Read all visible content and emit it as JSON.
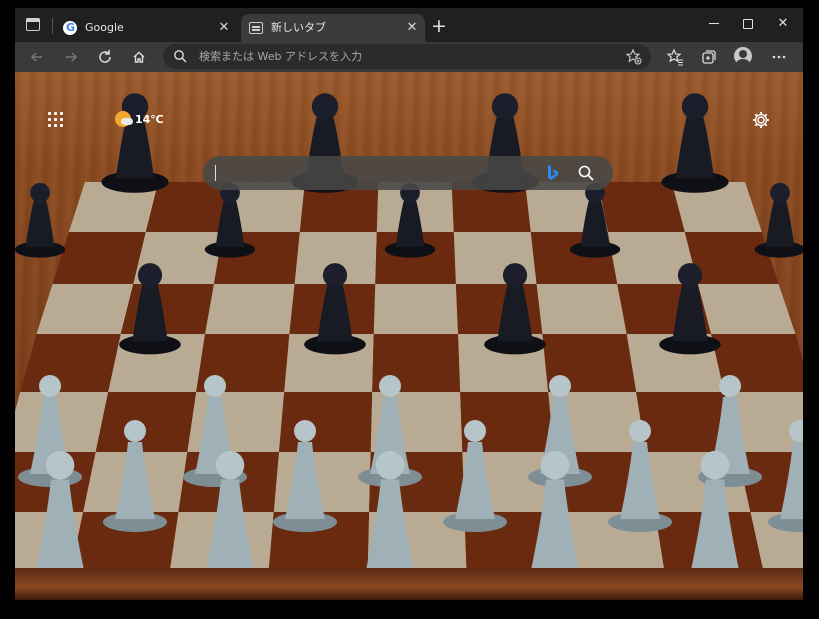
{
  "tabs": [
    {
      "title": "Google",
      "favicon": "google-g-icon",
      "active": false
    },
    {
      "title": "新しいタブ",
      "favicon": "new-tab-page-icon",
      "active": true
    }
  ],
  "toolbar": {
    "address_placeholder": "検索または Web アドレスを入力"
  },
  "newtab": {
    "weather": {
      "temp": "14℃",
      "icon": "partly-sunny-icon"
    },
    "search_value": "",
    "background": "chess-board-photo"
  },
  "colors": {
    "titlebar": "#202020",
    "toolbar": "#3a3a3a",
    "bing_blue": "#2a8af0"
  }
}
